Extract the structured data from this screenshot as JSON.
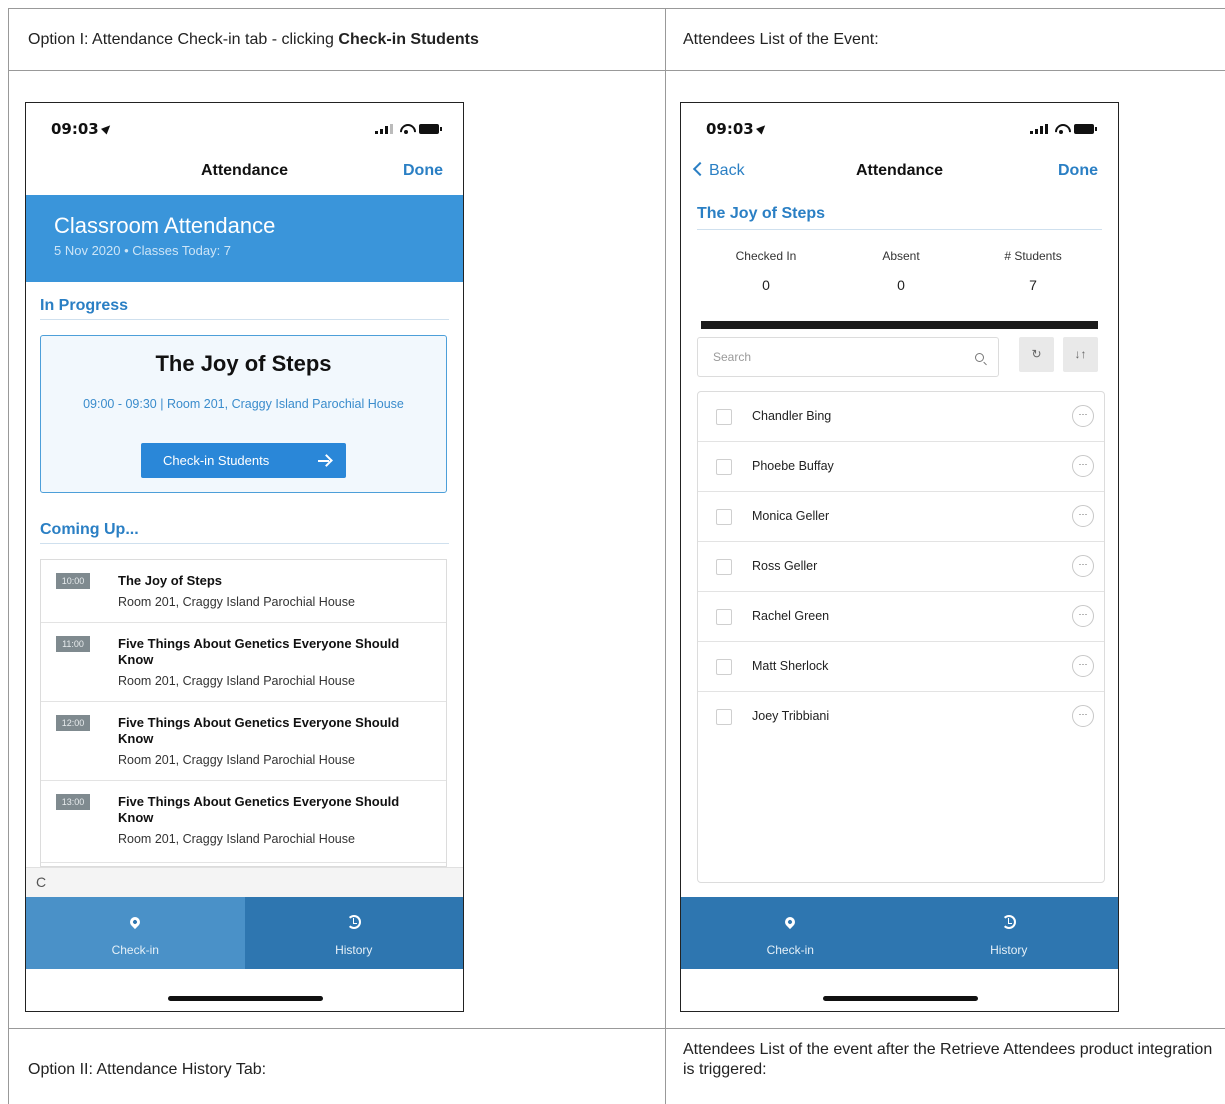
{
  "table": {
    "cell_1_prefix": "Option I: Attendance Check-in tab - clicking ",
    "cell_1_bold": "Check-in Students",
    "cell_2": "Attendees List of the Event:",
    "cell_3": "Option II: Attendance History Tab:",
    "cell_4": "Attendees List of the event after the Retrieve Attendees product integration is triggered:"
  },
  "phone1": {
    "status_time": "09:03",
    "nav_title": "Attendance",
    "nav_done": "Done",
    "hero_title": "Classroom Attendance",
    "hero_subtitle": "5 Nov 2020 • Classes Today: 7",
    "in_progress_heading": "In Progress",
    "card": {
      "title": "The Joy of Steps",
      "details": "09:00 - 09:30 | Room 201, Craggy Island Parochial House",
      "button": "Check-in Students"
    },
    "coming_up_heading": "Coming Up...",
    "upcoming": [
      {
        "time": "10:00",
        "title": "The Joy of Steps",
        "room": "Room 201, Craggy Island Parochial House"
      },
      {
        "time": "11:00",
        "title": "Five Things About Genetics Everyone Should Know",
        "room": "Room 201, Craggy Island Parochial House"
      },
      {
        "time": "12:00",
        "title": "Five Things About Genetics Everyone Should Know",
        "room": "Room 201, Craggy Island Parochial House"
      },
      {
        "time": "13:00",
        "title": "Five Things About Genetics Everyone Should Know",
        "room": "Room 201, Craggy Island Parochial House"
      }
    ],
    "refresh_glyph": "C",
    "tabs": {
      "checkin": "Check-in",
      "history": "History"
    }
  },
  "phone2": {
    "status_time": "09:03",
    "nav_back": "Back",
    "nav_title": "Attendance",
    "nav_done": "Done",
    "event_title": "The Joy of Steps",
    "stats": {
      "checked_in_label": "Checked In",
      "checked_in_value": "0",
      "absent_label": "Absent",
      "absent_value": "0",
      "students_label": "# Students",
      "students_value": "7"
    },
    "search_placeholder": "Search",
    "attendees": [
      "Chandler Bing",
      "Phoebe Buffay",
      "Monica Geller",
      "Ross Geller",
      "Rachel Green",
      "Matt Sherlock",
      "Joey Tribbiani"
    ],
    "tabs": {
      "checkin": "Check-in",
      "history": "History"
    }
  },
  "colors": {
    "accent": "#2a7fc4",
    "hero": "#3a95da",
    "tabbar": "#2e76b0",
    "tab_active": "#4a91c8"
  },
  "icons": [
    "location-arrow-icon",
    "signal-icon",
    "wifi-icon",
    "battery-icon",
    "back-chevron-icon",
    "arrow-right-icon",
    "refresh-icon",
    "map-pin-icon",
    "history-icon",
    "search-icon",
    "sort-icon",
    "more-icon"
  ]
}
